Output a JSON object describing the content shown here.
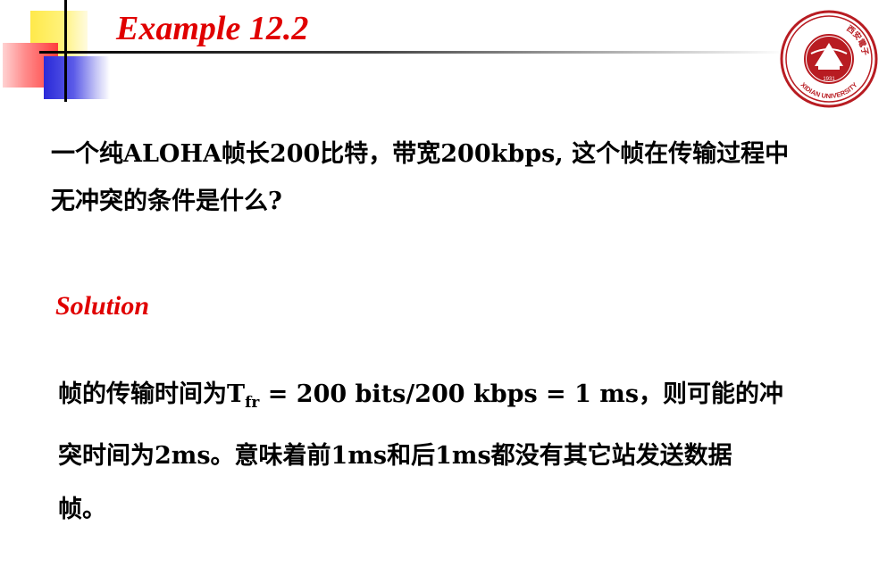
{
  "title": "Example 12.2",
  "logo": {
    "seal_text_top": "西安電子科技大學",
    "seal_year": "1931",
    "seal_text_bottom": "XIDIAN UNIVERSITY",
    "colors": {
      "seal": "#b81c22"
    }
  },
  "problem": {
    "text_line1": "一个纯ALOHA帧长200比特，带宽200kbps, 这个帧在传输过程中",
    "text_line2": "无冲突的条件是什么?"
  },
  "solution": {
    "heading": "Solution",
    "line1_prefix": "帧的传输时间为T",
    "line1_subscript": "fr",
    "line1_suffix": " = 200 bits/200 kbps = 1 ms，则可能的冲",
    "line2": "突时间为2ms。意味着前1ms和后1ms都没有其它站发送数据",
    "line3": "帧。"
  },
  "colors": {
    "title": "#e00000",
    "accent_yellow": "#ffe94a",
    "accent_red": "#ff3c3c",
    "accent_blue": "#2a2ad8",
    "text": "#000000"
  }
}
